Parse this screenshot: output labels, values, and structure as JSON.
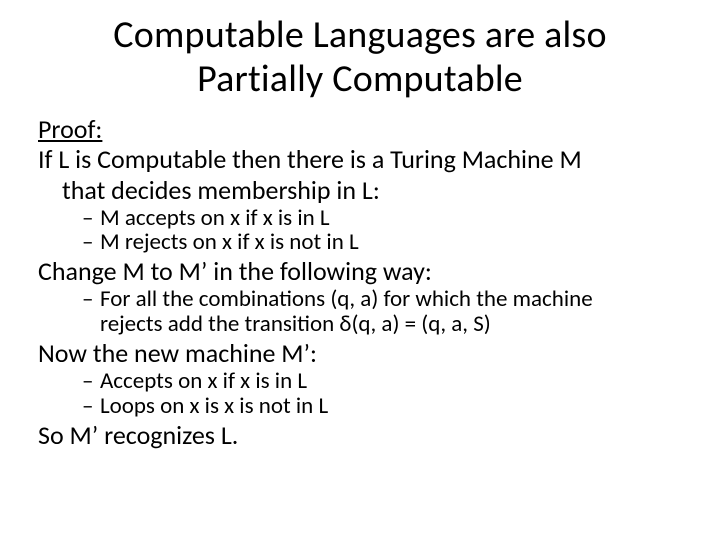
{
  "title_line1": "Computable Languages are also",
  "title_line2": "Partially Computable",
  "proof_label": "Proof:",
  "intro_line1": "If L is Computable then there is a Turing Machine M",
  "intro_line2": "that decides membership in L:",
  "bullets1": {
    "a": "M accepts on x if x is in L",
    "b": "M rejects on x if x is not in L"
  },
  "change_line": "Change M to M’ in the following way:",
  "bullets2": {
    "a_line1": "For all the combinations (q, a) for which the machine",
    "a_line2": "rejects add the transition δ(q, a) = (q, a, S)"
  },
  "now_line": "Now the new machine M’:",
  "bullets3": {
    "a": "Accepts on x if x is in L",
    "b": "Loops on x is x is not in L"
  },
  "so_line": "So M’ recognizes L.",
  "dash": "–"
}
